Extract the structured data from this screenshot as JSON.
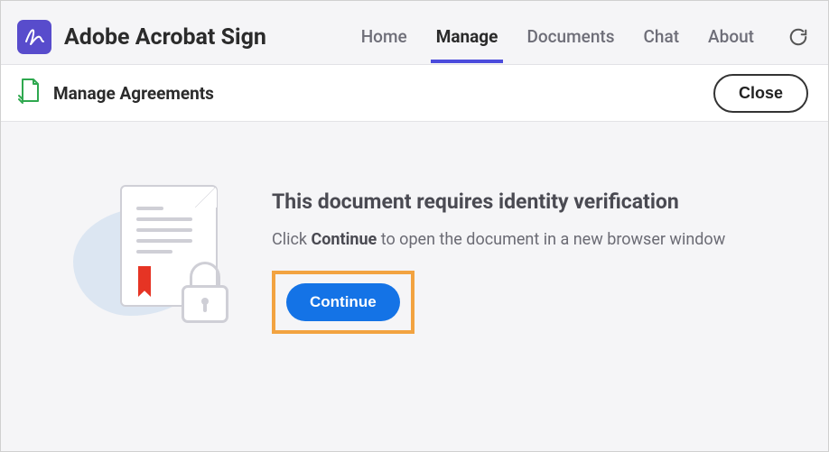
{
  "brand": {
    "title": "Adobe Acrobat Sign"
  },
  "nav": {
    "home": "Home",
    "manage": "Manage",
    "documents": "Documents",
    "chat": "Chat",
    "about": "About"
  },
  "subheader": {
    "title": "Manage Agreements",
    "close": "Close"
  },
  "message": {
    "heading": "This document requires identity verification",
    "body_prefix": "Click ",
    "body_strong": "Continue",
    "body_suffix": " to open the document in a new browser window",
    "continue": "Continue"
  }
}
